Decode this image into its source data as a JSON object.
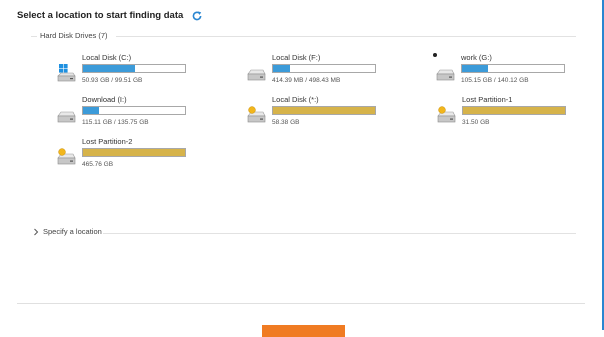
{
  "header": {
    "title": "Select a location to start finding data"
  },
  "section": {
    "label": "Hard Disk Drives (7)"
  },
  "colors": {
    "used_blue": "#3c9bd9",
    "used_gold": "#d6b34a",
    "accent": "#2a86d1",
    "scan_button": "#f07b22"
  },
  "drives": [
    {
      "name": "Local Disk (C:)",
      "size": "50.93 GB / 99.51 GB",
      "used_fraction": 0.512,
      "bar_color": "#3c9bd9",
      "icon": "windows-drive-icon",
      "selected": false
    },
    {
      "name": "Local Disk (F:)",
      "size": "414.39 MB / 498.43 MB",
      "used_fraction": 0.17,
      "bar_color": "#3c9bd9",
      "icon": "hard-drive-icon",
      "selected": false
    },
    {
      "name": "work (G:)",
      "size": "105.15 GB / 140.12 GB",
      "used_fraction": 0.25,
      "bar_color": "#3c9bd9",
      "icon": "hard-drive-icon",
      "selected": true
    },
    {
      "name": "Download (I:)",
      "size": "115.11 GB / 135.75 GB",
      "used_fraction": 0.152,
      "bar_color": "#3c9bd9",
      "icon": "hard-drive-icon",
      "selected": false
    },
    {
      "name": "Local Disk (*:)",
      "size": "58.38 GB",
      "used_fraction": 1.0,
      "bar_color": "#d6b34a",
      "icon": "lost-partition-icon",
      "selected": false
    },
    {
      "name": "Lost Partition-1",
      "size": "31.50 GB",
      "used_fraction": 1.0,
      "bar_color": "#d6b34a",
      "icon": "lost-partition-icon",
      "selected": false
    },
    {
      "name": "Lost Partition-2",
      "size": "465.76 GB",
      "used_fraction": 1.0,
      "bar_color": "#d6b34a",
      "icon": "lost-partition-icon",
      "selected": false
    }
  ],
  "specify": {
    "label": "Specify a location"
  }
}
